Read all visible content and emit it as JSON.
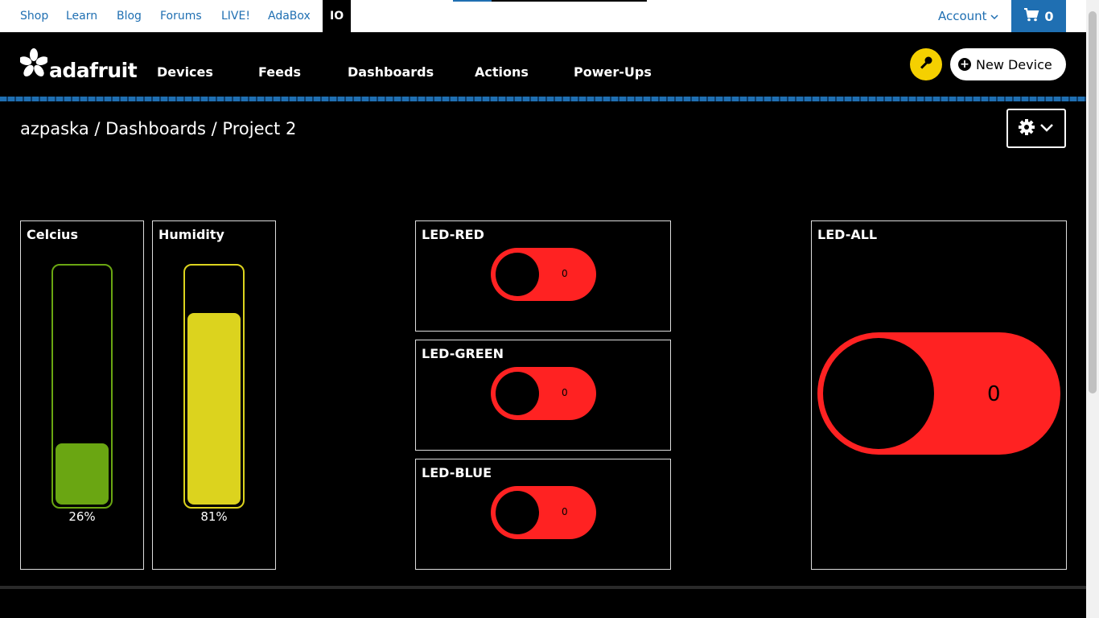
{
  "topbar": {
    "links": [
      "Shop",
      "Learn",
      "Blog",
      "Forums",
      "LIVE!",
      "AdaBox"
    ],
    "active": "IO",
    "account_label": "Account",
    "cart_count": "0",
    "colors": {
      "link": "#1f6fb2",
      "cart_bg": "#1f6fb2"
    }
  },
  "header": {
    "logo_text": "adafruit",
    "nav": [
      "Devices",
      "Feeds",
      "Dashboards",
      "Actions",
      "Power-Ups"
    ],
    "new_device_label": "New Device",
    "key_icon": "key-icon"
  },
  "breadcrumb": "azpaska / Dashboards / Project 2",
  "blocks": {
    "celcius": {
      "title": "Celcius",
      "value_label": "26%",
      "fraction": 0.26,
      "color": "#6aa612"
    },
    "humidity": {
      "title": "Humidity",
      "value_label": "81%",
      "fraction": 0.81,
      "color": "#dcd31e"
    },
    "led_red": {
      "title": "LED-RED",
      "value": "0"
    },
    "led_green": {
      "title": "LED-GREEN",
      "value": "0"
    },
    "led_blue": {
      "title": "LED-BLUE",
      "value": "0"
    },
    "led_all": {
      "title": "LED-ALL",
      "value": "0"
    },
    "toggle_color": "#ff2222"
  }
}
